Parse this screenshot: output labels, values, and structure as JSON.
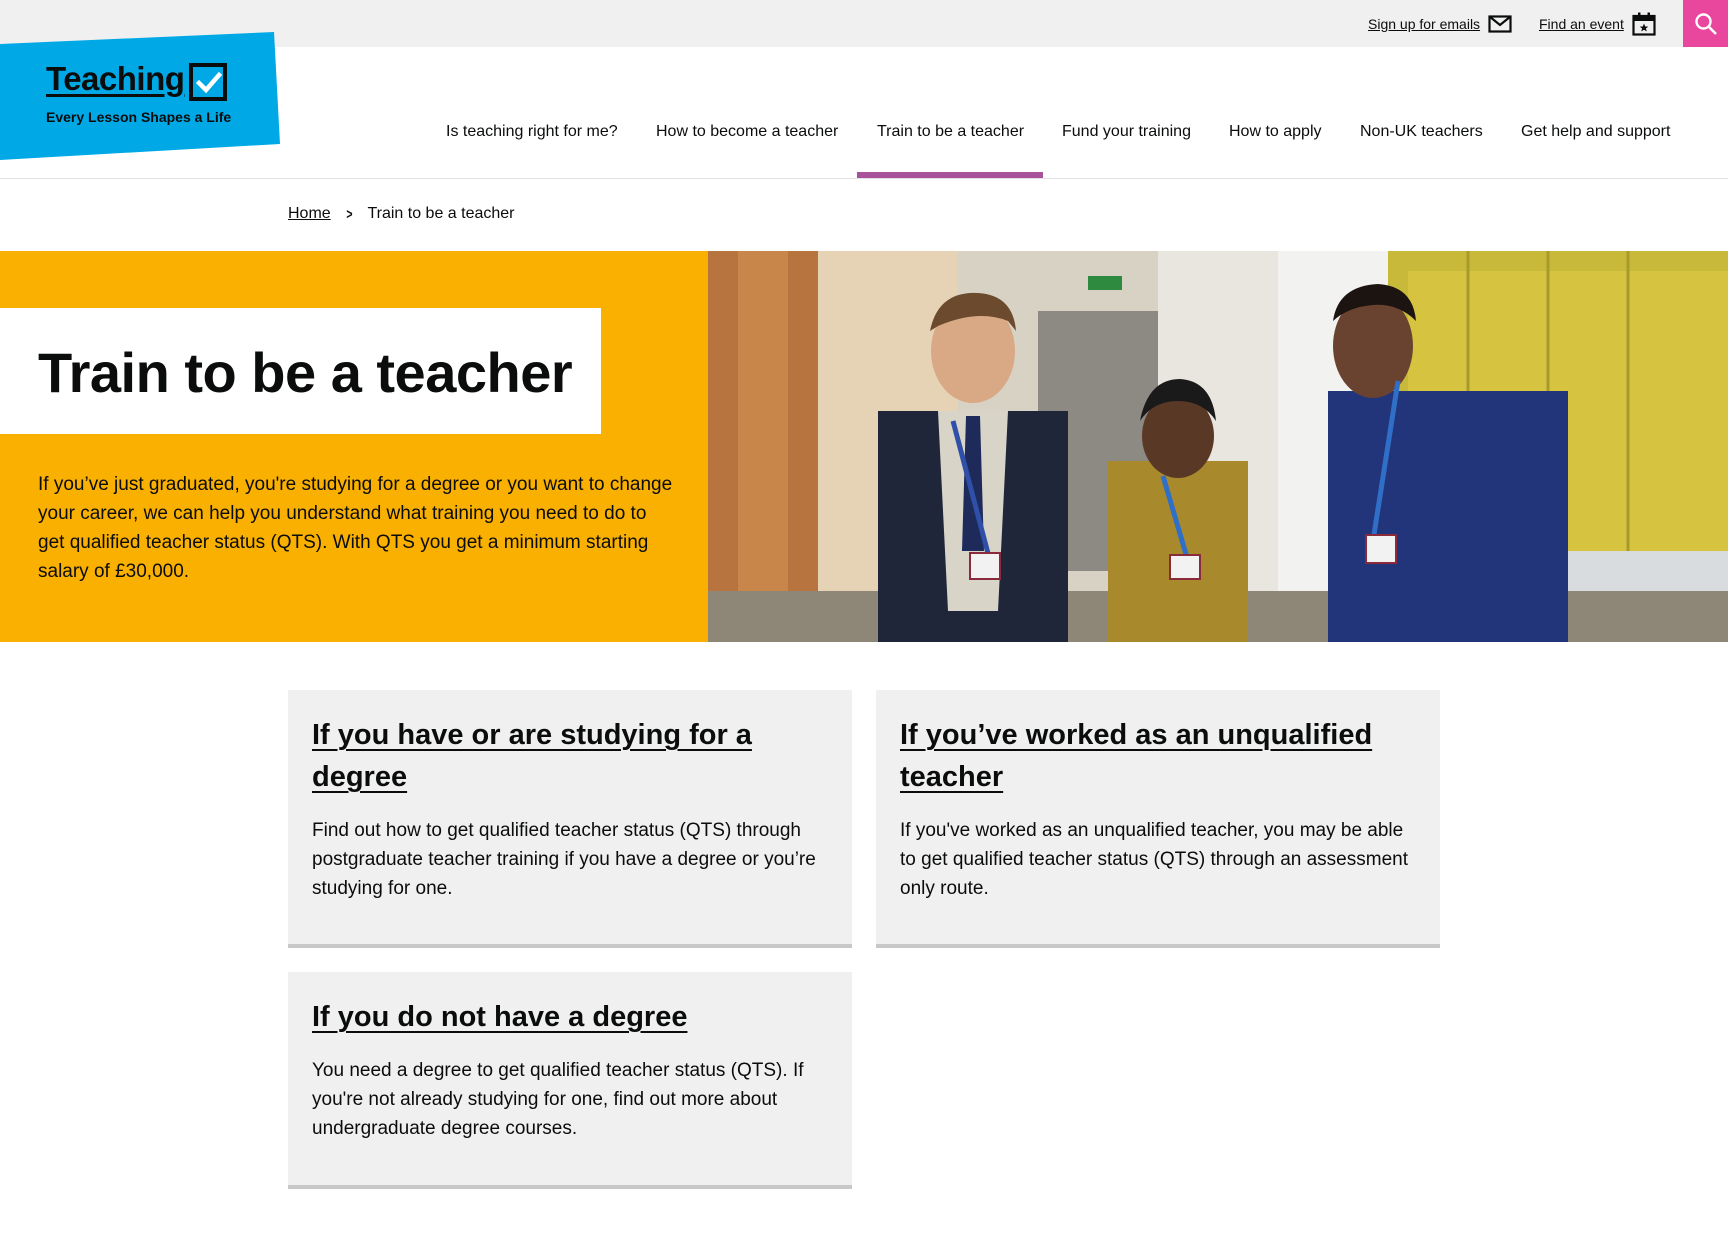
{
  "utility": {
    "signup_label": "Sign up for emails",
    "event_label": "Find an event",
    "search_icon": "search-icon"
  },
  "logo": {
    "word": "Teaching",
    "tagline": "Every Lesson Shapes a Life"
  },
  "nav": {
    "items": [
      {
        "label": "Is teaching right for me?"
      },
      {
        "label": "How to become a teacher"
      },
      {
        "label": "Train to be a teacher",
        "active": true
      },
      {
        "label": "Fund your training"
      },
      {
        "label": "How to apply"
      },
      {
        "label": "Non-UK teachers"
      },
      {
        "label": "Get help and support"
      }
    ]
  },
  "breadcrumb": {
    "home": "Home",
    "current": "Train to be a teacher"
  },
  "hero": {
    "title": "Train to be a teacher",
    "text": "If you’ve just graduated, you're studying for a degree or you want to change your career, we can help you understand what training you need to do to get qualified teacher status (QTS). With QTS you get a minimum starting salary of £30,000."
  },
  "cards": [
    {
      "title": "If you have or are studying for a degree",
      "text": "Find out how to get qualified teacher status (QTS) through postgraduate teacher training if you have a degree or you’re studying for one."
    },
    {
      "title": "If you’ve worked as an unqualified teacher",
      "text": "If you've worked as an unqualified teacher, you may be able to get qualified teacher status (QTS) through an assessment only route."
    },
    {
      "title": "If you do not have a degree",
      "text": "You need a degree to get qualified teacher status (QTS). If you're not already studying for one, find out more about undergraduate degree courses."
    }
  ],
  "colors": {
    "brand_blue": "#00a8e6",
    "hero_yellow": "#f9b000",
    "nav_active": "#a8529b",
    "search_pink": "#e8479d",
    "card_bg": "#f0f0f0"
  }
}
